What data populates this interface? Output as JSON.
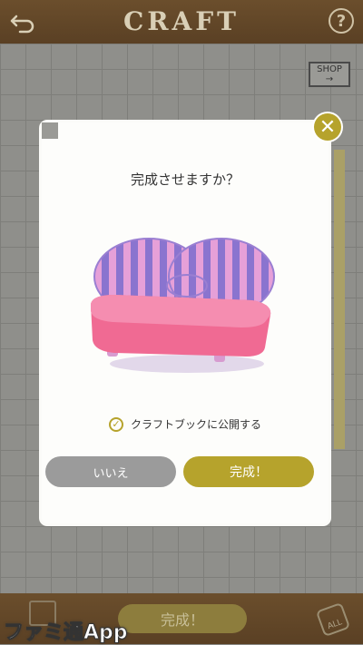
{
  "header": {
    "title": "CRAFT",
    "help_label": "?"
  },
  "shop": {
    "label": "SHOP",
    "arrow": "→"
  },
  "dialog": {
    "question": "完成させますか？",
    "publish_checkbox_label": "クラフトブックに公開する",
    "publish_checked": true,
    "no_label": "いいえ",
    "yes_label": "完成！",
    "close_label": "✕"
  },
  "bottombar": {
    "complete_label": "完成！",
    "all_label": "ALL"
  },
  "watermark": {
    "text": "ファミ通App"
  },
  "colors": {
    "accent": "#b6a32c",
    "wood": "#5a4024",
    "grey_button": "#9b9b9b"
  }
}
